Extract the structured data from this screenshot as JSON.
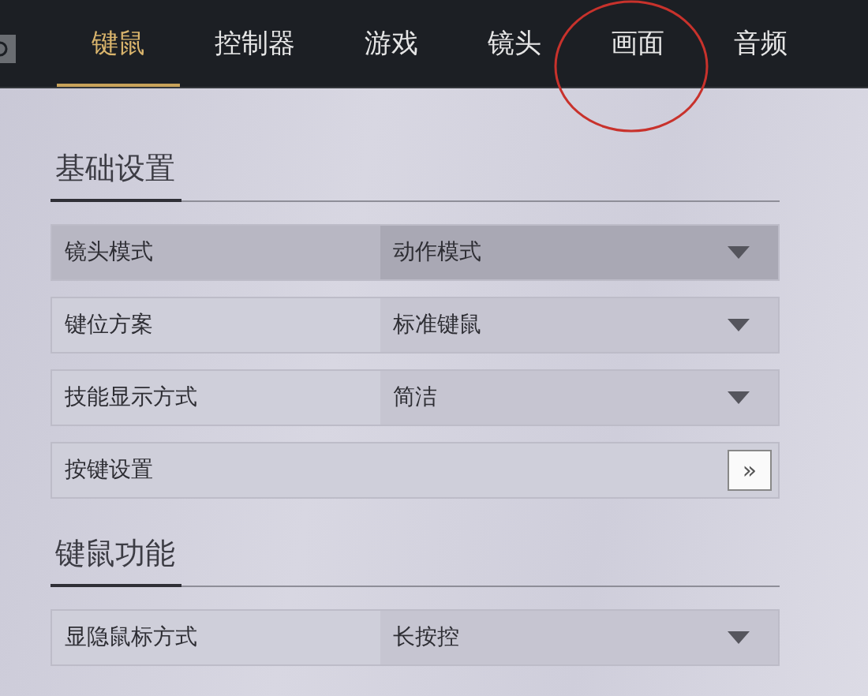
{
  "tabs": [
    {
      "label": "键鼠",
      "selected": true
    },
    {
      "label": "控制器",
      "selected": false
    },
    {
      "label": "游戏",
      "selected": false
    },
    {
      "label": "镜头",
      "selected": false
    },
    {
      "label": "画面",
      "selected": false
    },
    {
      "label": "音频",
      "selected": false
    }
  ],
  "sections": [
    {
      "title": "基础设置",
      "rows": [
        {
          "kind": "dropdown",
          "label": "镜头模式",
          "value": "动作模式",
          "selected": true
        },
        {
          "kind": "dropdown",
          "label": "键位方案",
          "value": "标准键鼠",
          "selected": false
        },
        {
          "kind": "dropdown",
          "label": "技能显示方式",
          "value": "简洁",
          "selected": false
        },
        {
          "kind": "link",
          "label": "按键设置",
          "button": "»",
          "selected": false
        }
      ]
    },
    {
      "title": "键鼠功能",
      "rows": [
        {
          "kind": "dropdown",
          "label": "显隐鼠标方式",
          "value": "长按控",
          "selected": false
        }
      ]
    }
  ]
}
